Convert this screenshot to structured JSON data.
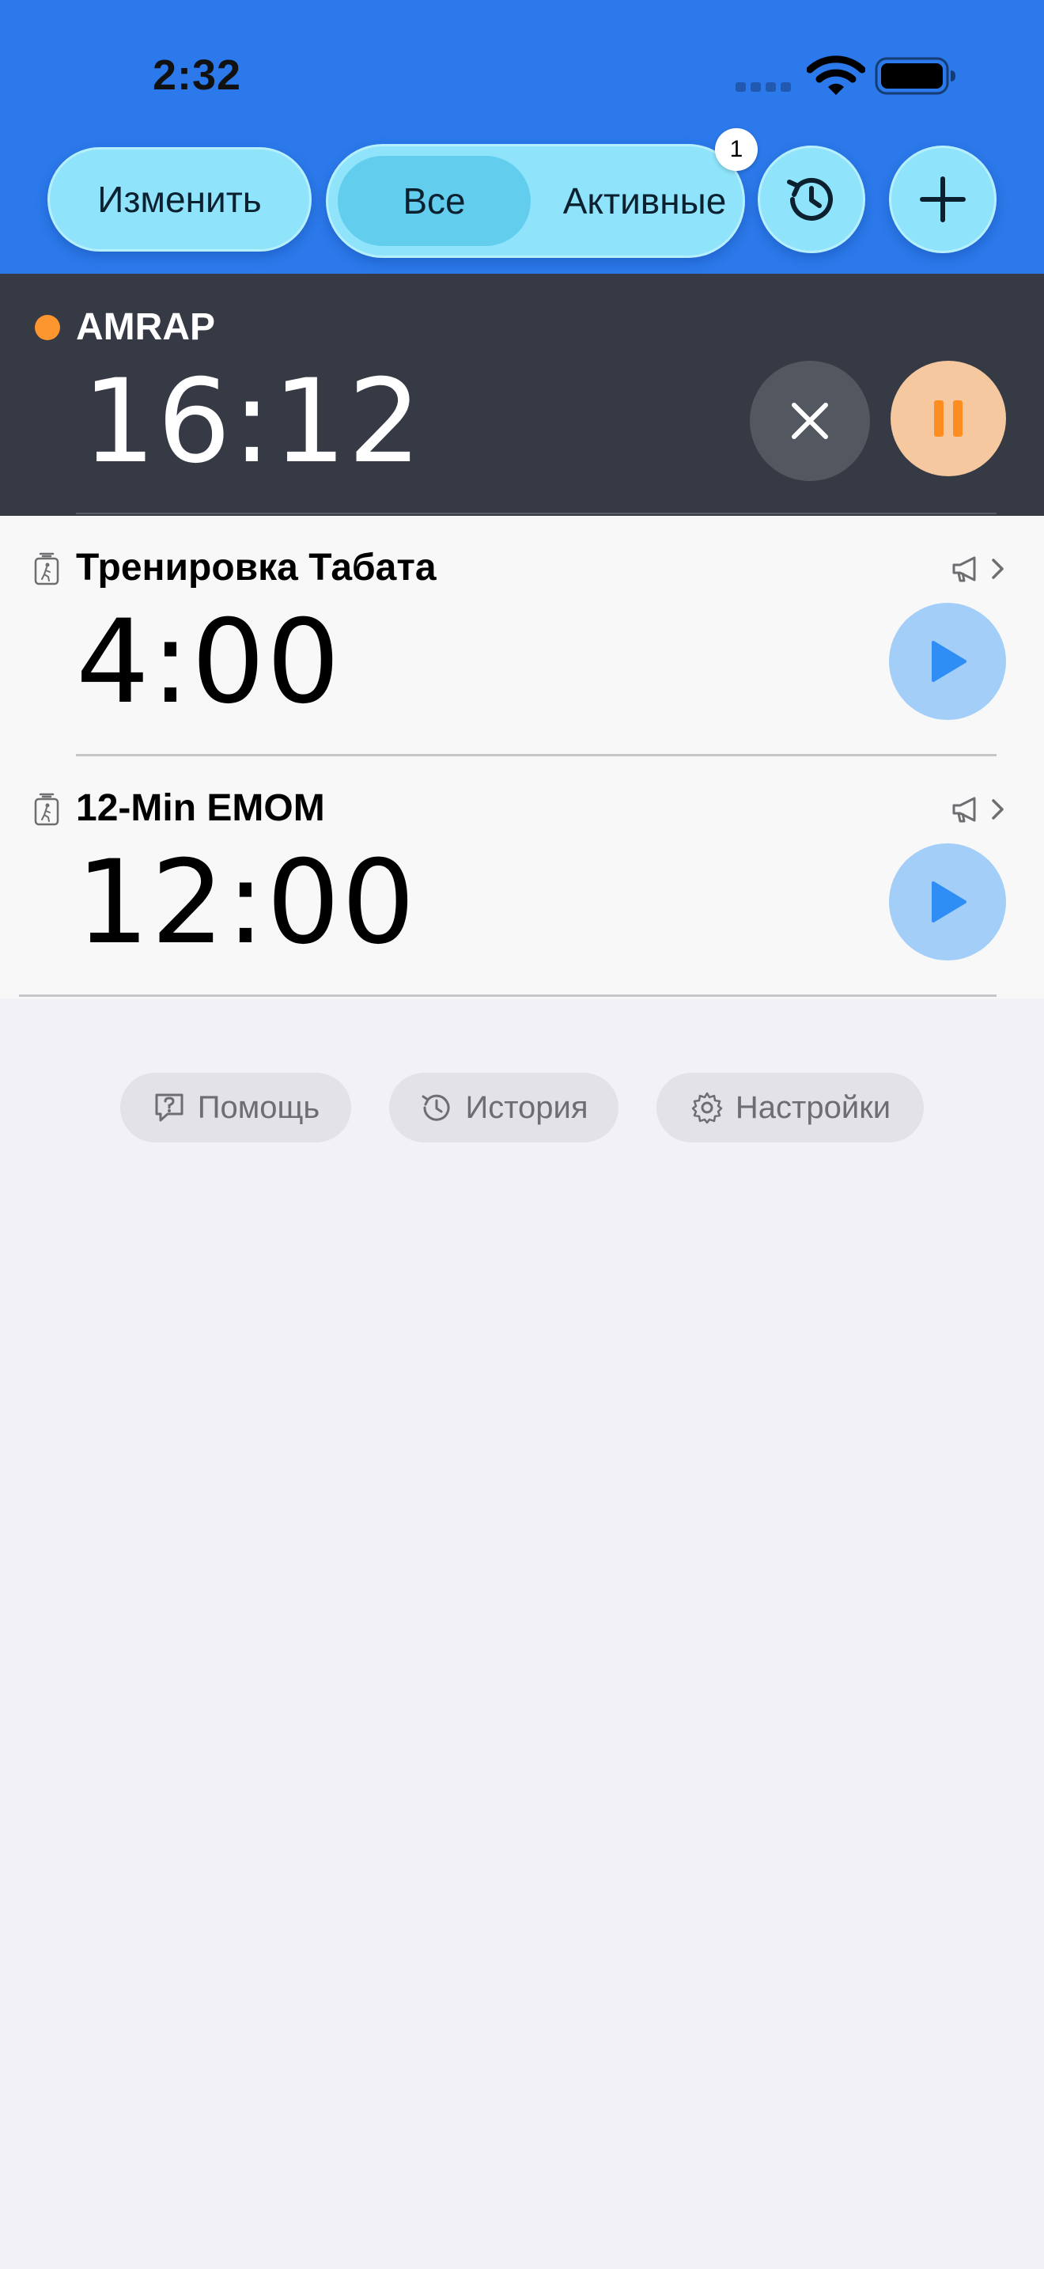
{
  "status_bar": {
    "time": "2:32"
  },
  "toolbar": {
    "edit_label": "Изменить",
    "segments": [
      "Все",
      "Активные"
    ],
    "selected_segment": "Все",
    "active_badge": "1",
    "history_icon": "clock-arrow-icon",
    "add_icon": "plus-icon"
  },
  "active_timer": {
    "name": "AMRAP",
    "time": "16:12",
    "status_color": "#fe9630",
    "cancel_icon": "close-icon",
    "pause_icon": "pause-icon"
  },
  "timers": [
    {
      "name": "Тренировка Табата",
      "time": "4:00",
      "icon": "workout-timer-icon",
      "announce_icon": "megaphone-icon",
      "play_icon": "play-icon"
    },
    {
      "name": "12-Min EMOM",
      "time": "12:00",
      "icon": "workout-timer-icon",
      "announce_icon": "megaphone-icon",
      "play_icon": "play-icon"
    }
  ],
  "footer_links": {
    "help": "Помощь",
    "history": "История",
    "settings": "Настройки"
  },
  "colors": {
    "header_bg": "#2b79ea",
    "accent_blue": "#2e8ef5",
    "accent_orange": "#fe9630",
    "active_row_bg": "#363a44"
  }
}
